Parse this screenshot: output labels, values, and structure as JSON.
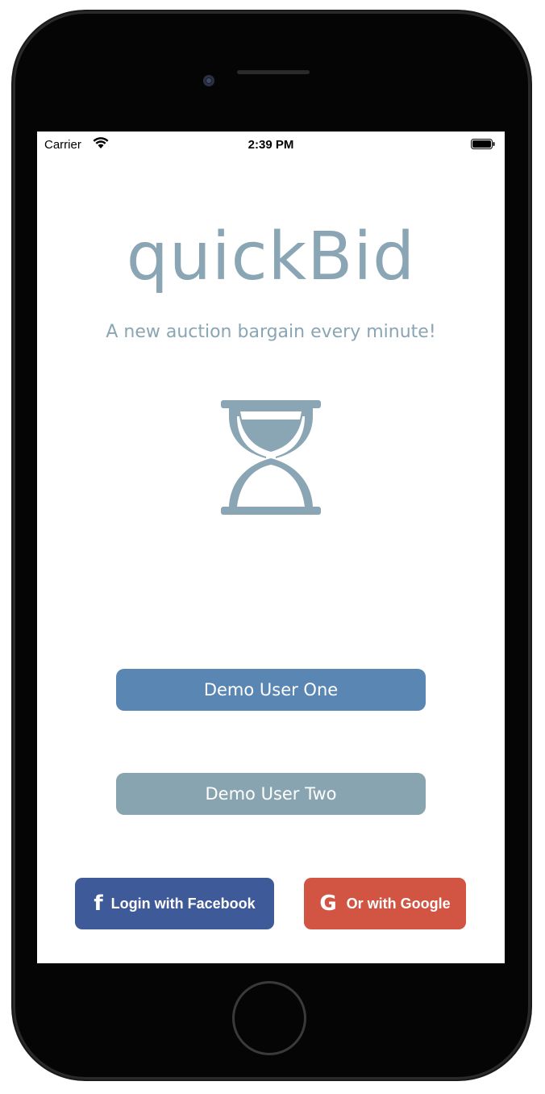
{
  "status_bar": {
    "carrier": "Carrier",
    "time": "2:39 PM"
  },
  "app": {
    "title": "quickBid",
    "tagline": "A new auction bargain every minute!",
    "logo_icon": "hourglass-icon",
    "accent_color": "#8aa5b3"
  },
  "buttons": {
    "demo_user_one": "Demo User One",
    "demo_user_two": "Demo User Two",
    "facebook": "Login with Facebook",
    "google": "Or with Google"
  },
  "colors": {
    "demo_one_bg": "#5a86b4",
    "demo_two_bg": "#88a4b0",
    "facebook_bg": "#3f5a98",
    "google_bg": "#d25443"
  }
}
